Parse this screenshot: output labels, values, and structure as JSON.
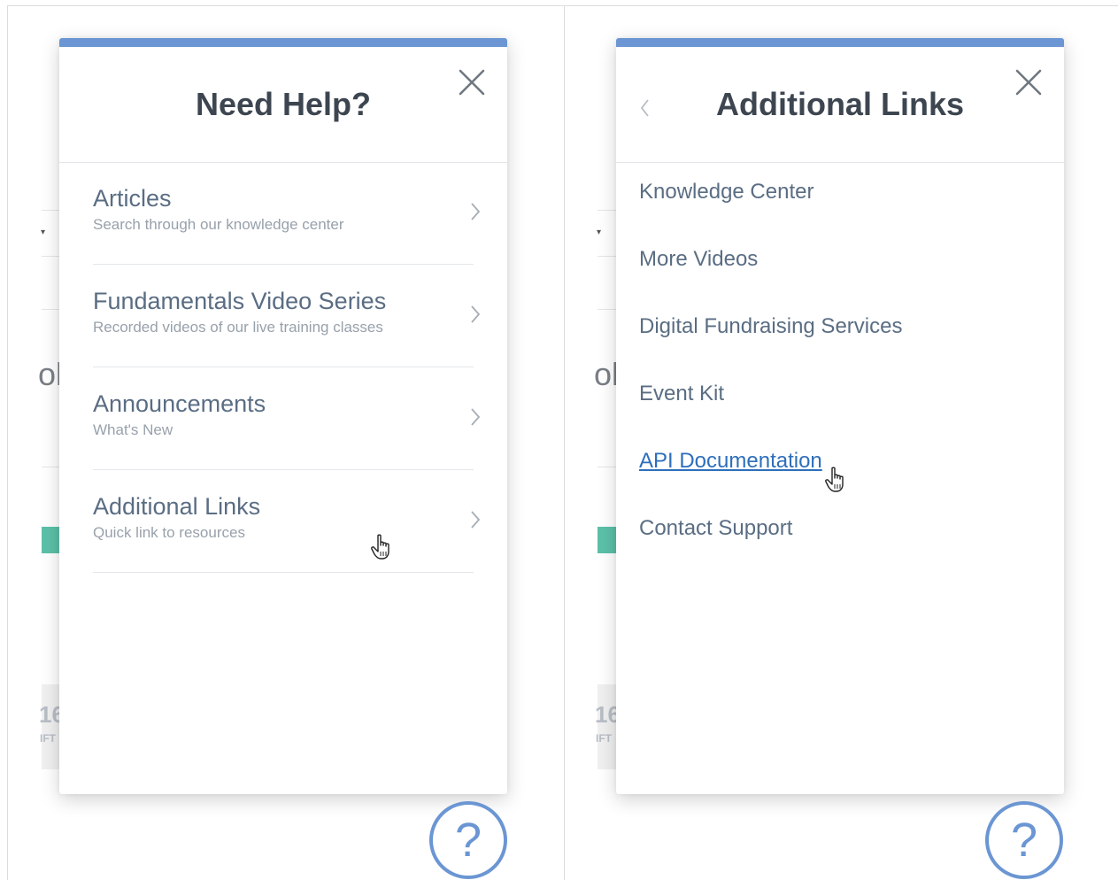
{
  "left_panel": {
    "title": "Need Help?",
    "items": [
      {
        "title": "Articles",
        "subtitle": "Search through our knowledge center"
      },
      {
        "title": "Fundamentals Video Series",
        "subtitle": "Recorded videos of our live training classes"
      },
      {
        "title": "Announcements",
        "subtitle": "What's New"
      },
      {
        "title": "Additional Links",
        "subtitle": "Quick link to resources"
      }
    ]
  },
  "right_panel": {
    "title": "Additional Links",
    "links": [
      {
        "label": "Knowledge Center"
      },
      {
        "label": "More Videos"
      },
      {
        "label": "Digital Fundraising Services"
      },
      {
        "label": "Event Kit"
      },
      {
        "label": "API Documentation",
        "state": "hovered"
      },
      {
        "label": "Contact Support"
      }
    ]
  },
  "help_button": {
    "label": "?"
  },
  "background": {
    "fragment_number": "16",
    "fragment_label": "IFT",
    "fragment_char": "ol"
  },
  "colors": {
    "accent": "#6b96d3",
    "title_text": "#3d4650",
    "item_text": "#5a6d83",
    "subtitle_text": "#98a1ab",
    "active_link": "#2e6fbb",
    "teal": "#5cc0a8"
  },
  "icons": {
    "close": "close-icon",
    "back": "chevron-left-icon",
    "item_arrow": "chevron-right-icon",
    "cursor": "hand-cursor-icon",
    "help": "question-mark-icon"
  }
}
